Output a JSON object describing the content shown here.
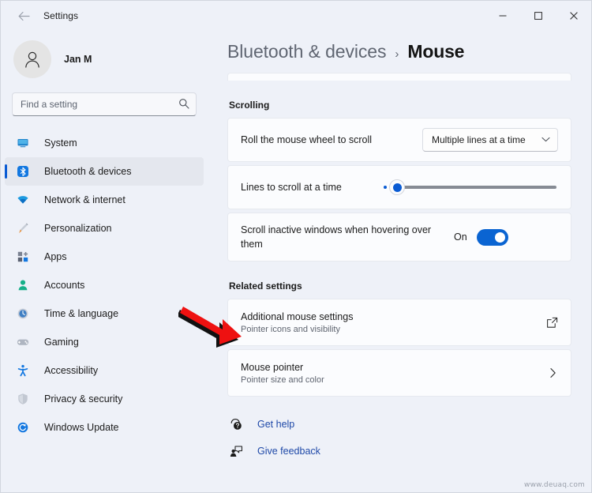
{
  "window": {
    "title": "Settings",
    "back_icon": "back-arrow-icon",
    "controls": {
      "minimize": "—",
      "maximize": "□",
      "close": "✕"
    }
  },
  "sidebar": {
    "profile": {
      "name": "Jan M",
      "avatar_icon": "person-avatar-icon"
    },
    "search": {
      "placeholder": "Find a setting",
      "value": "",
      "icon": "search-icon"
    },
    "items": [
      {
        "label": "System",
        "icon": "monitor-icon",
        "active": false
      },
      {
        "label": "Bluetooth & devices",
        "icon": "bluetooth-icon",
        "active": true
      },
      {
        "label": "Network & internet",
        "icon": "wifi-icon",
        "active": false
      },
      {
        "label": "Personalization",
        "icon": "paintbrush-icon",
        "active": false
      },
      {
        "label": "Apps",
        "icon": "apps-icon",
        "active": false
      },
      {
        "label": "Accounts",
        "icon": "account-person-icon",
        "active": false
      },
      {
        "label": "Time & language",
        "icon": "clock-icon",
        "active": false
      },
      {
        "label": "Gaming",
        "icon": "gamepad-icon",
        "active": false
      },
      {
        "label": "Accessibility",
        "icon": "accessibility-person-icon",
        "active": false
      },
      {
        "label": "Privacy & security",
        "icon": "shield-icon",
        "active": false
      },
      {
        "label": "Windows Update",
        "icon": "update-refresh-icon",
        "active": false
      }
    ]
  },
  "header": {
    "breadcrumb_parent": "Bluetooth & devices",
    "breadcrumb_separator": "›",
    "breadcrumb_current": "Mouse"
  },
  "main": {
    "scrolling": {
      "section_title": "Scrolling",
      "wheel_row": {
        "label": "Roll the mouse wheel to scroll",
        "dropdown_value": "Multiple lines at a time",
        "dropdown_icon": "chevron-down-icon"
      },
      "lines_row": {
        "label": "Lines to scroll at a time",
        "slider_value": 3,
        "slider_min": 1,
        "slider_max": 100
      },
      "inactive_row": {
        "label": "Scroll inactive windows when hovering over them",
        "toggle_state": "On",
        "toggle_on": true
      }
    },
    "related": {
      "section_title": "Related settings",
      "items": [
        {
          "title": "Additional mouse settings",
          "subtitle": "Pointer icons and visibility",
          "action_icon": "external-link-icon"
        },
        {
          "title": "Mouse pointer",
          "subtitle": "Pointer size and color",
          "action_icon": "chevron-right-icon"
        }
      ]
    },
    "footer_links": [
      {
        "label": "Get help",
        "icon": "help-question-icon"
      },
      {
        "label": "Give feedback",
        "icon": "feedback-person-icon"
      }
    ]
  },
  "annotation": {
    "arrow": "red-arrow-pointing-to-additional-mouse-settings"
  },
  "watermark": "www.deuaq.com",
  "colors": {
    "accent": "#0a5bd3",
    "toggle_on": "#0a64d2",
    "link": "#1f49a8",
    "background": "#eef1f8",
    "card": "#fbfcfe",
    "annotation_red": "#ee1111"
  }
}
